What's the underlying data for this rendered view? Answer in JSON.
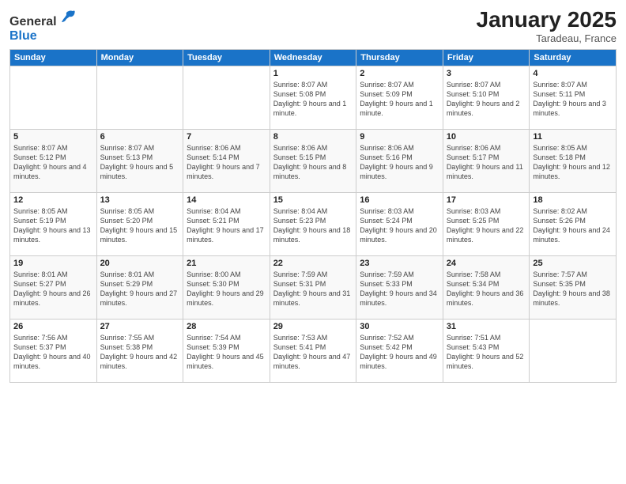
{
  "header": {
    "logo_general": "General",
    "logo_blue": "Blue",
    "month": "January 2025",
    "location": "Taradeau, France"
  },
  "days_of_week": [
    "Sunday",
    "Monday",
    "Tuesday",
    "Wednesday",
    "Thursday",
    "Friday",
    "Saturday"
  ],
  "weeks": [
    [
      {
        "day": "",
        "sunrise": "",
        "sunset": "",
        "daylight": ""
      },
      {
        "day": "",
        "sunrise": "",
        "sunset": "",
        "daylight": ""
      },
      {
        "day": "",
        "sunrise": "",
        "sunset": "",
        "daylight": ""
      },
      {
        "day": "1",
        "sunrise": "Sunrise: 8:07 AM",
        "sunset": "Sunset: 5:08 PM",
        "daylight": "Daylight: 9 hours and 1 minute."
      },
      {
        "day": "2",
        "sunrise": "Sunrise: 8:07 AM",
        "sunset": "Sunset: 5:09 PM",
        "daylight": "Daylight: 9 hours and 1 minute."
      },
      {
        "day": "3",
        "sunrise": "Sunrise: 8:07 AM",
        "sunset": "Sunset: 5:10 PM",
        "daylight": "Daylight: 9 hours and 2 minutes."
      },
      {
        "day": "4",
        "sunrise": "Sunrise: 8:07 AM",
        "sunset": "Sunset: 5:11 PM",
        "daylight": "Daylight: 9 hours and 3 minutes."
      }
    ],
    [
      {
        "day": "5",
        "sunrise": "Sunrise: 8:07 AM",
        "sunset": "Sunset: 5:12 PM",
        "daylight": "Daylight: 9 hours and 4 minutes."
      },
      {
        "day": "6",
        "sunrise": "Sunrise: 8:07 AM",
        "sunset": "Sunset: 5:13 PM",
        "daylight": "Daylight: 9 hours and 5 minutes."
      },
      {
        "day": "7",
        "sunrise": "Sunrise: 8:06 AM",
        "sunset": "Sunset: 5:14 PM",
        "daylight": "Daylight: 9 hours and 7 minutes."
      },
      {
        "day": "8",
        "sunrise": "Sunrise: 8:06 AM",
        "sunset": "Sunset: 5:15 PM",
        "daylight": "Daylight: 9 hours and 8 minutes."
      },
      {
        "day": "9",
        "sunrise": "Sunrise: 8:06 AM",
        "sunset": "Sunset: 5:16 PM",
        "daylight": "Daylight: 9 hours and 9 minutes."
      },
      {
        "day": "10",
        "sunrise": "Sunrise: 8:06 AM",
        "sunset": "Sunset: 5:17 PM",
        "daylight": "Daylight: 9 hours and 11 minutes."
      },
      {
        "day": "11",
        "sunrise": "Sunrise: 8:05 AM",
        "sunset": "Sunset: 5:18 PM",
        "daylight": "Daylight: 9 hours and 12 minutes."
      }
    ],
    [
      {
        "day": "12",
        "sunrise": "Sunrise: 8:05 AM",
        "sunset": "Sunset: 5:19 PM",
        "daylight": "Daylight: 9 hours and 13 minutes."
      },
      {
        "day": "13",
        "sunrise": "Sunrise: 8:05 AM",
        "sunset": "Sunset: 5:20 PM",
        "daylight": "Daylight: 9 hours and 15 minutes."
      },
      {
        "day": "14",
        "sunrise": "Sunrise: 8:04 AM",
        "sunset": "Sunset: 5:21 PM",
        "daylight": "Daylight: 9 hours and 17 minutes."
      },
      {
        "day": "15",
        "sunrise": "Sunrise: 8:04 AM",
        "sunset": "Sunset: 5:23 PM",
        "daylight": "Daylight: 9 hours and 18 minutes."
      },
      {
        "day": "16",
        "sunrise": "Sunrise: 8:03 AM",
        "sunset": "Sunset: 5:24 PM",
        "daylight": "Daylight: 9 hours and 20 minutes."
      },
      {
        "day": "17",
        "sunrise": "Sunrise: 8:03 AM",
        "sunset": "Sunset: 5:25 PM",
        "daylight": "Daylight: 9 hours and 22 minutes."
      },
      {
        "day": "18",
        "sunrise": "Sunrise: 8:02 AM",
        "sunset": "Sunset: 5:26 PM",
        "daylight": "Daylight: 9 hours and 24 minutes."
      }
    ],
    [
      {
        "day": "19",
        "sunrise": "Sunrise: 8:01 AM",
        "sunset": "Sunset: 5:27 PM",
        "daylight": "Daylight: 9 hours and 26 minutes."
      },
      {
        "day": "20",
        "sunrise": "Sunrise: 8:01 AM",
        "sunset": "Sunset: 5:29 PM",
        "daylight": "Daylight: 9 hours and 27 minutes."
      },
      {
        "day": "21",
        "sunrise": "Sunrise: 8:00 AM",
        "sunset": "Sunset: 5:30 PM",
        "daylight": "Daylight: 9 hours and 29 minutes."
      },
      {
        "day": "22",
        "sunrise": "Sunrise: 7:59 AM",
        "sunset": "Sunset: 5:31 PM",
        "daylight": "Daylight: 9 hours and 31 minutes."
      },
      {
        "day": "23",
        "sunrise": "Sunrise: 7:59 AM",
        "sunset": "Sunset: 5:33 PM",
        "daylight": "Daylight: 9 hours and 34 minutes."
      },
      {
        "day": "24",
        "sunrise": "Sunrise: 7:58 AM",
        "sunset": "Sunset: 5:34 PM",
        "daylight": "Daylight: 9 hours and 36 minutes."
      },
      {
        "day": "25",
        "sunrise": "Sunrise: 7:57 AM",
        "sunset": "Sunset: 5:35 PM",
        "daylight": "Daylight: 9 hours and 38 minutes."
      }
    ],
    [
      {
        "day": "26",
        "sunrise": "Sunrise: 7:56 AM",
        "sunset": "Sunset: 5:37 PM",
        "daylight": "Daylight: 9 hours and 40 minutes."
      },
      {
        "day": "27",
        "sunrise": "Sunrise: 7:55 AM",
        "sunset": "Sunset: 5:38 PM",
        "daylight": "Daylight: 9 hours and 42 minutes."
      },
      {
        "day": "28",
        "sunrise": "Sunrise: 7:54 AM",
        "sunset": "Sunset: 5:39 PM",
        "daylight": "Daylight: 9 hours and 45 minutes."
      },
      {
        "day": "29",
        "sunrise": "Sunrise: 7:53 AM",
        "sunset": "Sunset: 5:41 PM",
        "daylight": "Daylight: 9 hours and 47 minutes."
      },
      {
        "day": "30",
        "sunrise": "Sunrise: 7:52 AM",
        "sunset": "Sunset: 5:42 PM",
        "daylight": "Daylight: 9 hours and 49 minutes."
      },
      {
        "day": "31",
        "sunrise": "Sunrise: 7:51 AM",
        "sunset": "Sunset: 5:43 PM",
        "daylight": "Daylight: 9 hours and 52 minutes."
      },
      {
        "day": "",
        "sunrise": "",
        "sunset": "",
        "daylight": ""
      }
    ]
  ]
}
